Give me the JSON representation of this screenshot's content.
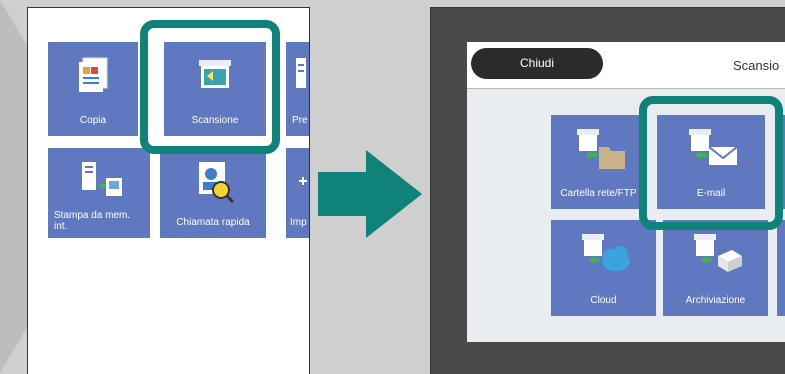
{
  "left_panel": {
    "tiles": [
      {
        "label": "Copia",
        "icon": "copy-icon"
      },
      {
        "label": "Scansione",
        "icon": "scan-icon"
      },
      {
        "label": "Pre",
        "icon": "preset-icon"
      },
      {
        "label": "Stampa da mem.\nint.",
        "icon": "print-memory-icon"
      },
      {
        "label": "Chiamata rapida",
        "icon": "speed-dial-icon"
      },
      {
        "label": "Imp",
        "icon": "settings-icon"
      }
    ]
  },
  "right_screen": {
    "close_label": "Chiudi",
    "title": "Scansio",
    "tiles": [
      {
        "label": "Cartella rete/FTP",
        "icon": "network-folder-icon"
      },
      {
        "label": "E-mail",
        "icon": "email-icon"
      },
      {
        "label": "Cloud",
        "icon": "cloud-icon"
      },
      {
        "label": "Archiviazione",
        "icon": "storage-icon"
      }
    ]
  },
  "colors": {
    "tile": "#5f78bf",
    "highlight": "#0f8279",
    "arrow": "#0f8279"
  }
}
